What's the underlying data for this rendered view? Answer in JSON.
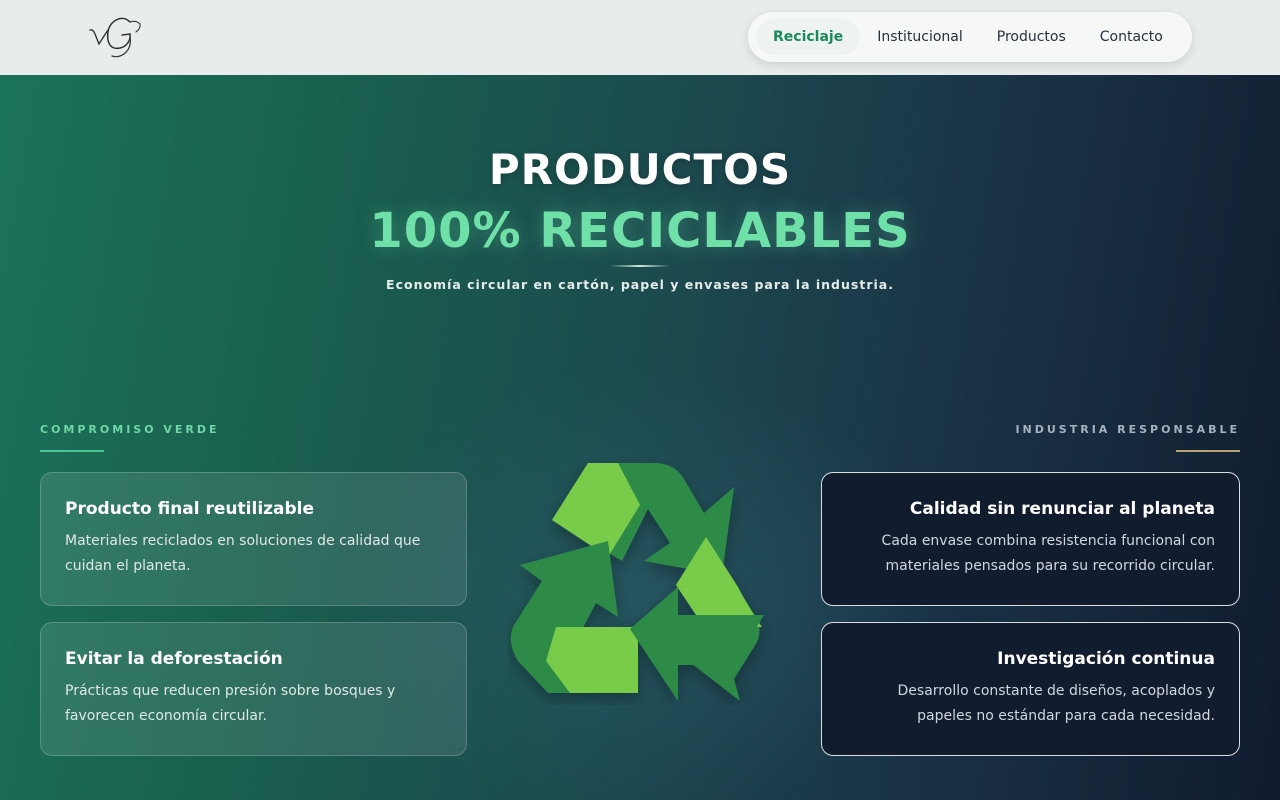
{
  "header": {
    "logo_text": "vG",
    "nav": [
      {
        "label": "Reciclaje",
        "active": true
      },
      {
        "label": "Institucional",
        "active": false
      },
      {
        "label": "Productos",
        "active": false
      },
      {
        "label": "Contacto",
        "active": false
      }
    ]
  },
  "hero": {
    "title_line1": "PRODUCTOS",
    "title_line2": "100% RECICLABLES",
    "subtitle": "Economía circular en cartón, papel y envases para la industria."
  },
  "left": {
    "eyebrow": "COMPROMISO VERDE",
    "cards": [
      {
        "title": "Producto final reutilizable",
        "text": "Materiales reciclados en soluciones de calidad que cuidan el planeta."
      },
      {
        "title": "Evitar la deforestación",
        "text": "Prácticas que reducen presión sobre bosques y favorecen economía circular."
      }
    ]
  },
  "right": {
    "eyebrow": "INDUSTRIA RESPONSABLE",
    "cards": [
      {
        "title": "Calidad sin renunciar al planeta",
        "text": "Cada envase combina resistencia funcional con materiales pensados para su recorrido circular."
      },
      {
        "title": "Investigación continua",
        "text": "Desarrollo constante de diseños, acoplados y papeles no estándar para cada necesidad."
      }
    ]
  },
  "icons": {
    "logo": "vg-monogram-logo",
    "recycle": "recycle-icon"
  },
  "colors": {
    "accent_green": "#6fe0a8",
    "nav_active": "#1a8a5a",
    "recycle_light": "#79cc48",
    "recycle_dark": "#2e8a47"
  }
}
